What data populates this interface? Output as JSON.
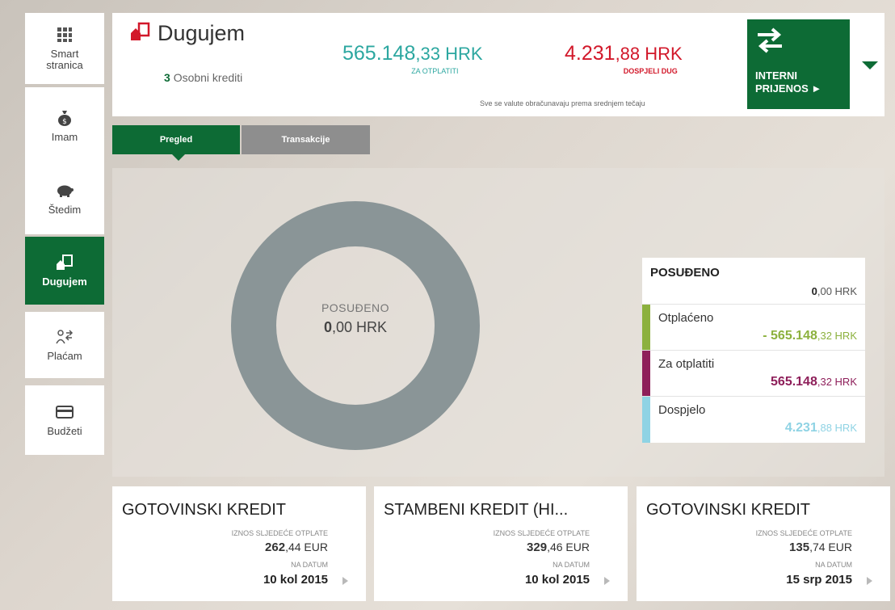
{
  "sidebar": {
    "items": [
      {
        "label": "Smart\nstranica",
        "icon": "grid-icon"
      },
      {
        "label": "Imam",
        "icon": "money-bag-icon"
      },
      {
        "label": "Štedim",
        "icon": "piggy-bank-icon"
      },
      {
        "label": "Dugujem",
        "icon": "house-document-icon",
        "active": true
      },
      {
        "label": "Plaćam",
        "icon": "payment-transfer-icon"
      },
      {
        "label": "Budžeti",
        "icon": "card-icon"
      }
    ]
  },
  "header": {
    "title": "Dugujem",
    "sub_count": "3",
    "sub_label": "Osobni krediti",
    "amount1_int": "565.148",
    "amount1_dec": ",33 HRK",
    "amount1_label": "ZA OTPLATITI",
    "amount2_int": "4.231",
    "amount2_dec": ",88 HRK",
    "amount2_label": "DOSPJELI DUG",
    "note": "Sve se valute obračunavaju prema srednjem tečaju",
    "transfer_label1": "INTERNI",
    "transfer_label2": "PRIJENOS ►"
  },
  "tabs": [
    {
      "label": "Pregled",
      "active": true
    },
    {
      "label": "Transakcije",
      "active": false
    }
  ],
  "donut": {
    "label": "POSUĐENO",
    "value_bold": "0",
    "value_rest": ",00 HRK",
    "color": "#8a9597"
  },
  "legend": {
    "title": "POSUĐENO",
    "total_bold": "0",
    "total_rest": ",00 HRK",
    "rows": [
      {
        "name": "Otplaćeno",
        "bold": "- 565.148",
        "rest": ",32 HRK",
        "color": "#8cb13e"
      },
      {
        "name": "Za otplatiti",
        "bold": "565.148",
        "rest": ",32 HRK",
        "color": "#8e1f5a"
      },
      {
        "name": "Dospjelo",
        "bold": "4.231",
        "rest": ",88 HRK",
        "color": "#8fd3e4"
      }
    ]
  },
  "cards": [
    {
      "title": "GOTOVINSKI KREDIT",
      "label1": "IZNOS SLJEDEĆE OTPLATE",
      "amount_bold": "262",
      "amount_rest": ",44 EUR",
      "label2": "NA DATUM",
      "date": "10 kol 2015"
    },
    {
      "title": "STAMBENI KREDIT (HI...",
      "label1": "IZNOS SLJEDEĆE OTPLATE",
      "amount_bold": "329",
      "amount_rest": ",46 EUR",
      "label2": "NA DATUM",
      "date": "10 kol 2015"
    },
    {
      "title": "GOTOVINSKI KREDIT",
      "label1": "IZNOS SLJEDEĆE OTPLATE",
      "amount_bold": "135",
      "amount_rest": ",74 EUR",
      "label2": "NA DATUM",
      "date": "15 srp 2015"
    }
  ]
}
